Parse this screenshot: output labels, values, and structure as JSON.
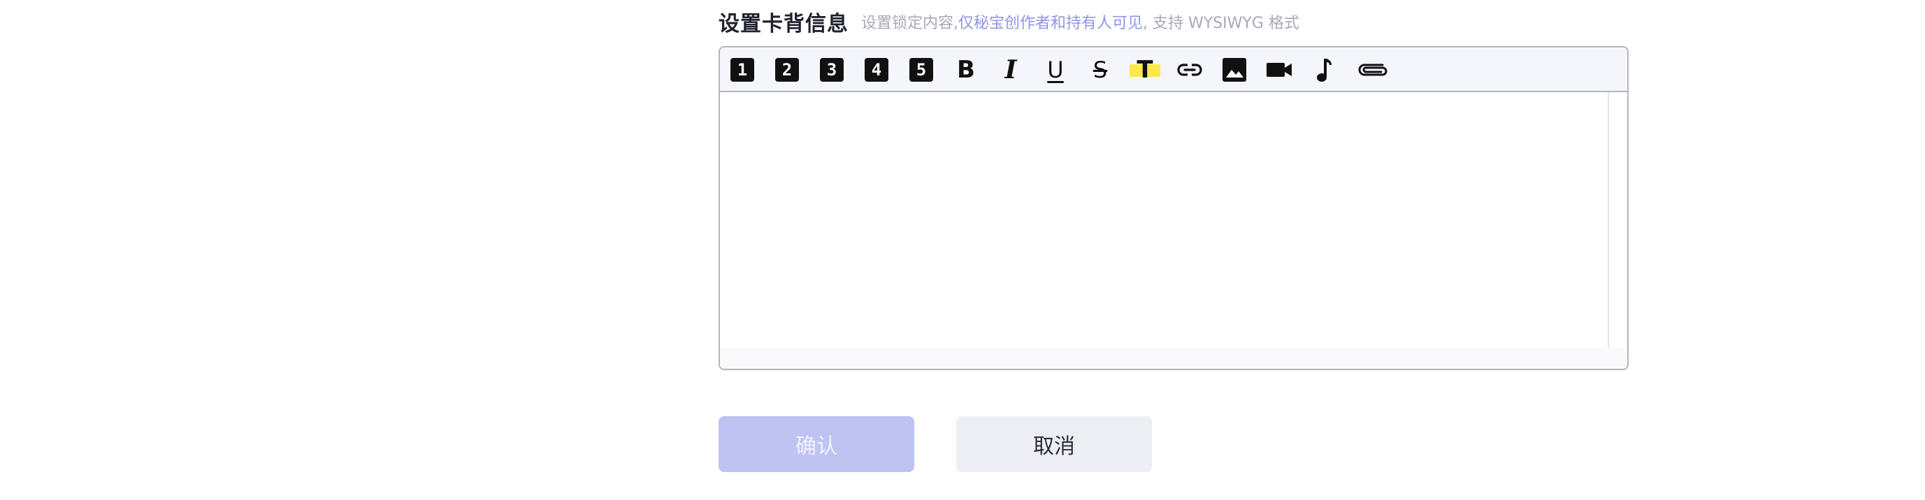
{
  "section": {
    "title": "设置卡背信息",
    "hint_prefix": "设置锁定内容,",
    "hint_highlight": "仅秘宝创作者和持有人可见",
    "hint_suffix": ", 支持 WYSIWYG 格式"
  },
  "toolbar": {
    "h1": "1",
    "h2": "2",
    "h3": "3",
    "h4": "4",
    "h5": "5",
    "bold": "B",
    "italic": "I",
    "underline": "U",
    "strike": "S",
    "highlight": "T",
    "icons": {
      "link": "link-icon",
      "image": "image-icon",
      "video": "video-icon",
      "audio": "music-note-icon",
      "attachment": "paperclip-icon"
    },
    "highlight_color": "#fde84a"
  },
  "editor": {
    "content": ""
  },
  "buttons": {
    "confirm": "确认",
    "cancel": "取消"
  },
  "colors": {
    "confirm_bg": "#bfc3f1",
    "cancel_bg": "#edeff4",
    "hint_highlight": "#8f95e8"
  }
}
